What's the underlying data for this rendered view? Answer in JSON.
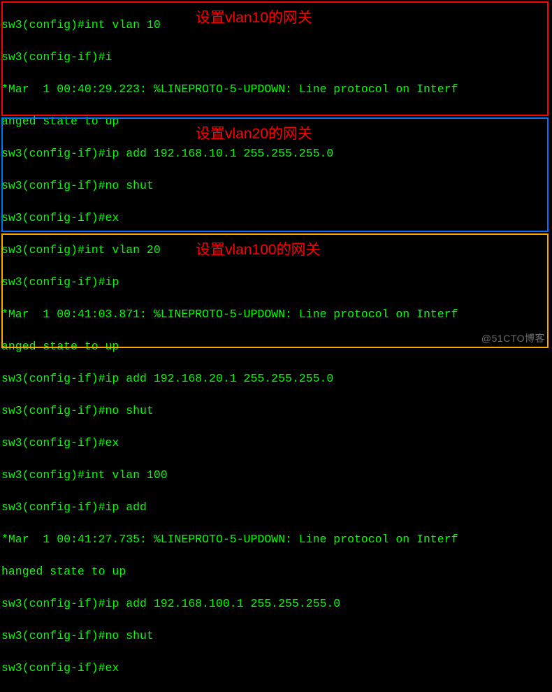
{
  "terminal": {
    "block1": {
      "l1": "sw3(config)#int vlan 10",
      "l2": "sw3(config-if)#i",
      "l3": "*Mar  1 00:40:29.223: %LINEPROTO-5-UPDOWN: Line protocol on Interf",
      "l4": "anged state to up",
      "l5": "sw3(config-if)#ip add 192.168.10.1 255.255.255.0",
      "l6": "sw3(config-if)#no shut",
      "l7": "sw3(config-if)#ex"
    },
    "block2": {
      "l1": "sw3(config)#int vlan 20",
      "l2": "sw3(config-if)#ip",
      "l3": "*Mar  1 00:41:03.871: %LINEPROTO-5-UPDOWN: Line protocol on Interf",
      "l4": "anged state to up",
      "l5": "sw3(config-if)#ip add 192.168.20.1 255.255.255.0",
      "l6": "sw3(config-if)#no shut",
      "l7": "sw3(config-if)#ex"
    },
    "block3": {
      "l1": "sw3(config)#int vlan 100",
      "l2": "sw3(config-if)#ip add",
      "l3": "*Mar  1 00:41:27.735: %LINEPROTO-5-UPDOWN: Line protocol on Interf",
      "l4": "hanged state to up",
      "l5": "sw3(config-if)#ip add 192.168.100.1 255.255.255.0",
      "l6": "sw3(config-if)#no shut",
      "l7": "sw3(config-if)#ex"
    }
  },
  "annotations": {
    "a1": "设置vlan10的网关",
    "a2": "设置vlan20的网关",
    "a3": "设置vlan100的网关"
  },
  "highlight_colors": {
    "red": "#ff0000",
    "blue": "#0070ff",
    "orange": "#ffa500"
  },
  "watermark": "@51CTO博客"
}
